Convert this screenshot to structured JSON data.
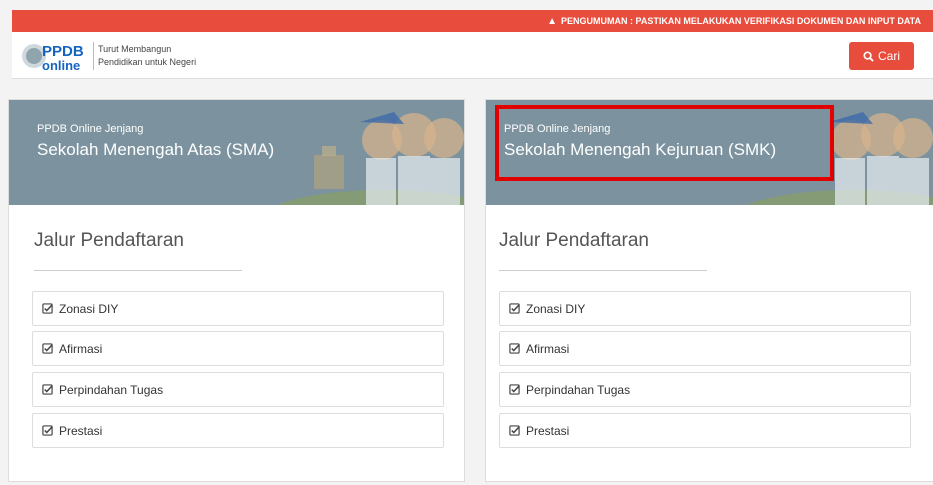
{
  "announcement": {
    "text": "PENGUMUMAN : PASTIKAN MELAKUKAN VERIFIKASI DOKUMEN DAN INPUT DATA",
    "icon": "warning-icon"
  },
  "header": {
    "logo_text_1": "PPDB",
    "logo_text_2": "online",
    "tagline_line1": "Turut Membangun",
    "tagline_line2": "Pendidikan untuk Negeri",
    "search_label": "Cari"
  },
  "colors": {
    "accent": "#e74c3c",
    "banner": "#7c939f",
    "highlight": "#e00000"
  },
  "cards": [
    {
      "kicker": "PPDB Online Jenjang",
      "name": "Sekolah Menengah Atas (SMA)",
      "section_title": "Jalur Pendaftaran",
      "jalur": [
        "Zonasi DIY",
        "Afirmasi",
        "Perpindahan Tugas",
        "Prestasi"
      ]
    },
    {
      "kicker": "PPDB Online Jenjang",
      "name": "Sekolah Menengah Kejuruan (SMK)",
      "section_title": "Jalur Pendaftaran",
      "jalur": [
        "Zonasi DIY",
        "Afirmasi",
        "Perpindahan Tugas",
        "Prestasi"
      ]
    }
  ]
}
